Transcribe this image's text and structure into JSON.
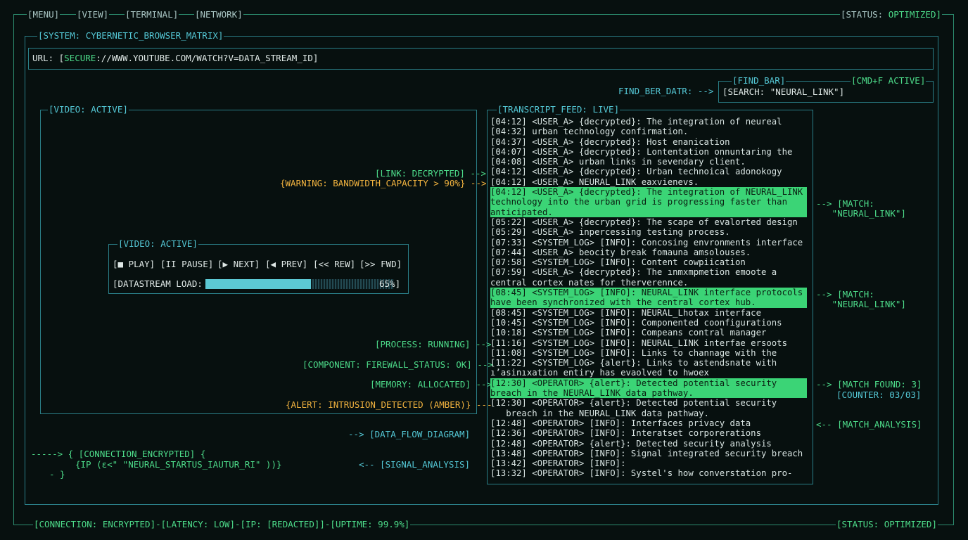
{
  "menu": {
    "items": [
      "[MENU]",
      "[VIEW]",
      "[TERMINAL]",
      "[NETWORK]"
    ],
    "status_prefix": "[STATUS: ",
    "status_value": "OPTIMIZED]"
  },
  "system": {
    "title": "[SYSTEM: CYBERNETIC_BROWSER_MATRIX]",
    "url_label": "URL: [",
    "url_secure": "SECURE",
    "url_rest": "://WWW.YOUTUBE.COM/WATCH?V=DATA_STREAM_ID]"
  },
  "find": {
    "box_title": "[FIND_BAR]",
    "cmd": "[CMD+F ACTIVE]",
    "arrow_label": "FIND_BER_DATR: -->",
    "search_text": "[SEARCH: \"NEURAL_LINK\"]"
  },
  "video": {
    "outer_title": "[VIDEO: ACTIVE]",
    "inner_title": "[VIDEO: ACTIVE]",
    "controls": [
      "[■ PLAY]",
      "[II PAUSE]",
      "[▶ NEXT]",
      "[◀ PREV]",
      "[<< REW]",
      "[>> FWD]"
    ],
    "load_label": "[DATASTREAM LOAD:",
    "load_percent": "65%]",
    "load_value": 0.65
  },
  "left_annotations": [
    "[LINK: DECRYPTED] -->",
    "{WARNING: BANDWIDTH_CAPACITY > 90%} -->",
    "[PROCESS: RUNNING] -->",
    "[COMPONENT: FIREWALL_STATUS: OK] -->",
    "[MEMORY: ALLOCATED] -->",
    "{ALERT: INTRUSION_DETECTED (AMBER)} ---",
    "--> [DATA_FLOW_DIAGRAM]",
    "<-- [SIGNAL_ANALYSIS]"
  ],
  "connection": {
    "line1": "-----> { [CONNECTION_ENCRYPTED] {",
    "line2": "{IP (ɛ<\" \"NEURAL_STARTUS_IAUTUR_RI\" ))}",
    "line3": "- }"
  },
  "transcript": {
    "title": "[TRANSCRIPT_FEED: LIVE]",
    "lines": [
      {
        "text": "[04:12] <USER_A> {decrypted}: The integration of neureal",
        "hl": false
      },
      {
        "text": "[04:32] urban technology confirmation.",
        "hl": false
      },
      {
        "text": "[04:37] <USER_A> {decrypted}: Host enanication",
        "hl": false
      },
      {
        "text": "[04:07] <USER_A> {decrypted}: Lontentation onnuntaring the",
        "hl": false
      },
      {
        "text": "[04:08] <USER_A> urban links in sevendary client.",
        "hl": false
      },
      {
        "text": "[04:12] <USER_A> {decrypted}: Urban technoical adonokogy",
        "hl": false
      },
      {
        "text": "[04:12] <USER_A> NEURAL_LINK eaxvienevs.",
        "hl": false
      },
      {
        "text": "[04:12] <USER_A> {decrypted}: The integration of NEURAL_LINK",
        "hl": true
      },
      {
        "text": "technology into the urban grid is progressing faster than",
        "hl": true
      },
      {
        "text": "anticipated.",
        "hl": true
      },
      {
        "text": "[05:22] <USER_A> {decrypted}: The scape of evalorted design",
        "hl": false
      },
      {
        "text": "[05:29] <USER_A> inpercessing testing process.",
        "hl": false
      },
      {
        "text": "[07:33] <SYSTEM_LOG> [INFO]: Concosing envronments interface",
        "hl": false
      },
      {
        "text": "[07:44] <USER_A> beocity break fomauna amsolouses.",
        "hl": false
      },
      {
        "text": "[07:58] <SYSTEM_LOG> [INFO]: Content cowpiication",
        "hl": false
      },
      {
        "text": "[07:59] <USER_A> {decrypted}: The ınmxmpmetion emoote a",
        "hl": false
      },
      {
        "text": "central cortex nates for therverennce.",
        "hl": false
      },
      {
        "text": "[08:45] <SYSTEM_LOG> [INFO]: NEURAL_LINK interface protocols",
        "hl": true
      },
      {
        "text": "have been synchronized with the central cortex hub.",
        "hl": true
      },
      {
        "text": "[08:45] <SYSTEM_LOG> [INFO]: NEURAL_Lhotax interface",
        "hl": false
      },
      {
        "text": "[10:45] <SYSTEM_LOG> [INFO]: Componented coonfigurations",
        "hl": false
      },
      {
        "text": "[10:18] <SYSTEM_LOG> [INFO]: Compeans contral manager",
        "hl": false
      },
      {
        "text": "[11:16] <SYSTEM_LOG> [INFO]: NEURAL_LINK interfae ersoots",
        "hl": false
      },
      {
        "text": "[11:08] <SYSTEM_LOG> [INFO]: Links to channage with the",
        "hl": false
      },
      {
        "text": "[11:22] <SYSTEM_LOG> {alert}: Links to astendsnate with",
        "hl": false
      },
      {
        "text": "ıʼasinıxation entiry has evaolved to hwoex",
        "hl": false
      },
      {
        "text": "[12:30] <OPERATOR> {alert}: Detected potential security",
        "hl": true
      },
      {
        "text": "breach in the NEURAL_LINK data pathway.",
        "hl": true
      },
      {
        "text": "[12:30] <OPERATOR> {alert}: Detected potential security",
        "hl": false
      },
      {
        "text": "   breach in the NEURAL_LINK data pathway.",
        "hl": false
      },
      {
        "text": "[12:48] <OPERATOR> [INFO]: Interfaces privacy data",
        "hl": false
      },
      {
        "text": "[12:36] <OPERATOR> [INFO]: Interatset corporerations",
        "hl": false
      },
      {
        "text": "[12:48] <OPERATOR> {alert}: Detected security analysis",
        "hl": false
      },
      {
        "text": "[13:48] <OPERATOR> [INFO]: Signal integrated security breach",
        "hl": false
      },
      {
        "text": "[13:42] <OPERATOR> [INFO]:",
        "hl": false
      },
      {
        "text": "[13:32] <OPERATOR> [INFO]: Systel's how converstation pro-",
        "hl": false
      }
    ]
  },
  "matches": {
    "m1_arrow": "--> [MATCH:",
    "m1_value": "\"NEURAL_LINK\"]",
    "m2_arrow": "--> [MATCH:",
    "m2_value": "\"NEURAL_LINK\"]",
    "found": "--> [MATCH FOUND: 3]",
    "counter": "[COUNTER: 03/03]",
    "analysis": "<-- [MATCH_ANALYSIS]"
  },
  "footer": {
    "left": "[CONNECTION: ENCRYPTED]-[LATENCY: LOW]-[IP: [REDACTED]]-[UPTIME: 99.9%]",
    "right": "[STATUS: OPTIMIZED]"
  },
  "colors": {
    "green": "#4ddc8a",
    "cyan": "#54c8d6",
    "amber": "#f2b33f",
    "highlight": "#3bd476",
    "background": "#07100f"
  }
}
